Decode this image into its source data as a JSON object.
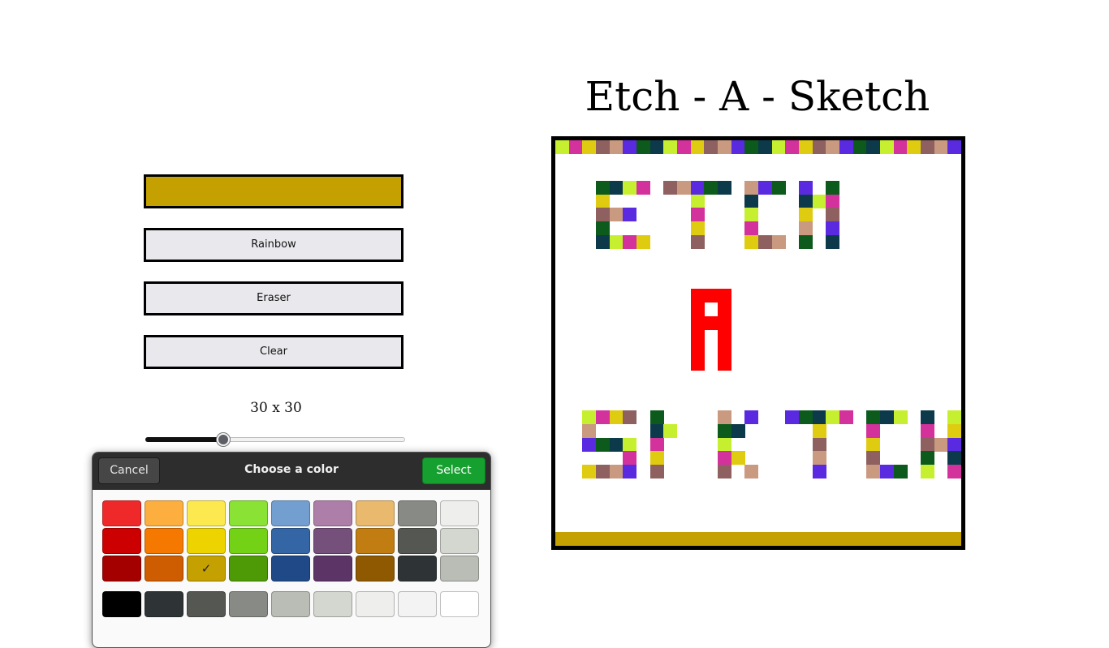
{
  "title": "Etch - A - Sketch",
  "controls": {
    "current_color": "#c4a000",
    "rainbow_label": "Rainbow",
    "eraser_label": "Eraser",
    "clear_label": "Clear",
    "grid_size_label": "30 x 30",
    "grid_size_value": 30,
    "slider_fraction": 0.3
  },
  "board": {
    "grid": 30,
    "bottom_row_color": "#c4a000",
    "red_letter_color": "#ff0000"
  },
  "color_dialog": {
    "cancel_label": "Cancel",
    "title": "Choose a color",
    "select_label": "Select",
    "selected": "#c4a000",
    "palette_columns": [
      [
        "#ef2929",
        "#cc0000",
        "#a40000"
      ],
      [
        "#fcaf3e",
        "#f57900",
        "#ce5c00"
      ],
      [
        "#fce94f",
        "#edd400",
        "#c4a000"
      ],
      [
        "#8ae234",
        "#73d216",
        "#4e9a06"
      ],
      [
        "#729fcf",
        "#3465a4",
        "#204a87"
      ],
      [
        "#ad7fa8",
        "#75507b",
        "#5c3566"
      ],
      [
        "#e9b96e",
        "#c17d11",
        "#8f5902"
      ],
      [
        "#888a85",
        "#555753",
        "#2e3436"
      ],
      [
        "#eeeeec",
        "#d3d7cf",
        "#babdb6"
      ]
    ],
    "grays": [
      "#000000",
      "#2e3436",
      "#555753",
      "#888a85",
      "#babdb6",
      "#d3d7cf",
      "#eeeeec",
      "#f3f3f3",
      "#ffffff"
    ],
    "check_mark": "✓"
  }
}
